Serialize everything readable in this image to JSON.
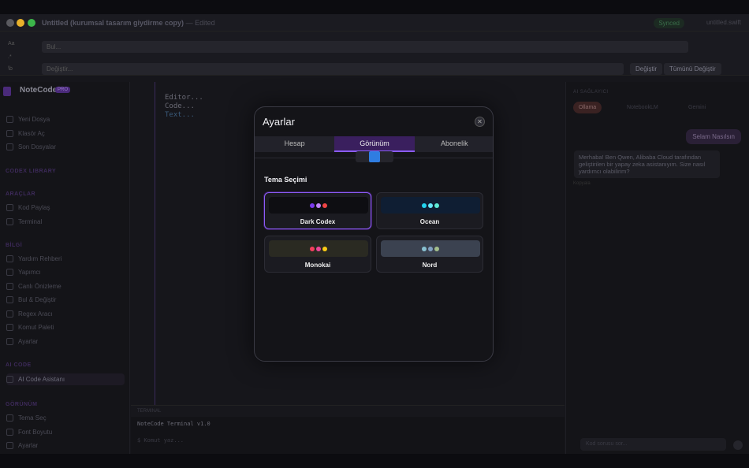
{
  "window": {
    "title": "Untitled (kurumsal tasarım giydirme copy)",
    "edited": "— Edited",
    "synced": "Synced",
    "file": "untitled.swift"
  },
  "find": {
    "side": [
      "Aa",
      ".*",
      "\\b"
    ],
    "find_placeholder": "Bul...",
    "replace_placeholder": "Değiştir...",
    "replace_btn": "Değiştir",
    "replace_all_btn": "Tümünü Değiştir"
  },
  "sidebar": {
    "app_name": "NoteCode",
    "pro": "PRO",
    "file_items": [
      "Yeni Dosya",
      "Klasör Aç",
      "Son Dosyalar"
    ],
    "library": "CODEX LIBRARY",
    "tools_header": "ARAÇLAR",
    "tools": [
      "Kod Paylaş",
      "Terminal"
    ],
    "info_header": "BİLGİ",
    "info": [
      "Yardım Rehberi",
      "Yapımcı",
      "Canlı Önizleme",
      "Bul & Değiştir",
      "Regex Aracı",
      "Komut Paleti",
      "Ayarlar"
    ],
    "ai_header": "AI CODE",
    "ai_item": "AI Code Asistanı",
    "view_header": "GÖRÜNÜM",
    "view": [
      "Tema Seç",
      "Font Boyutu",
      "Ayarlar"
    ]
  },
  "editor": {
    "lines": [
      "Editor...",
      "Code...",
      "Text..."
    ]
  },
  "terminal": {
    "header": "TERMINAL",
    "line": "NoteCode Terminal v1.0",
    "prompt": "$ Komut yaz..."
  },
  "ai": {
    "header": "AI SAĞLAYICI",
    "providers": [
      "Ollama",
      "NotebookLM",
      "Gemini"
    ],
    "user_msg": "Selam Nasılsın",
    "reply": "Merhaba! Ben Qwen, Alibaba Cloud tarafından geliştirilen bir yapay zeka asistanıyım. Size nasıl yardımcı olabilirim?",
    "copy": "Kopyala",
    "input_placeholder": "Kod sorusu sor..."
  },
  "modal": {
    "title": "Ayarlar",
    "tabs": [
      "Hesap",
      "Görünüm",
      "Abonelik"
    ],
    "section": "Tema Seçimi",
    "themes": [
      {
        "name": "Dark Codex",
        "bg": "#0e0e12",
        "dots": [
          "#7c3aed",
          "#c084fc",
          "#ef4444"
        ]
      },
      {
        "name": "Ocean",
        "bg": "#0f1e33",
        "dots": [
          "#22d3ee",
          "#67e8f9",
          "#5eead4"
        ]
      },
      {
        "name": "Monokai",
        "bg": "#2a2a22",
        "dots": [
          "#f43f5e",
          "#ec4899",
          "#facc15"
        ]
      },
      {
        "name": "Nord",
        "bg": "#3b4250",
        "dots": [
          "#88c0d0",
          "#81a1c1",
          "#a3be8c"
        ]
      }
    ]
  }
}
